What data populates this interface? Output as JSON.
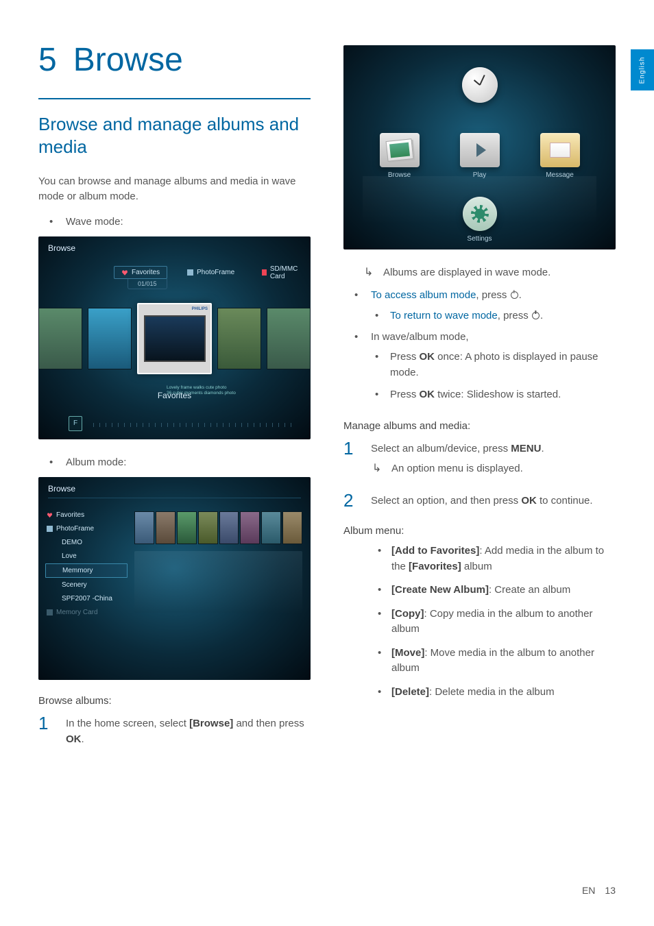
{
  "sideTab": "English",
  "chapter": {
    "num": "5",
    "title": "Browse"
  },
  "sectionTitle": "Browse and manage albums and media",
  "intro": "You can browse and manage albums and media in wave mode or album mode.",
  "waveLabel": "Wave mode:",
  "albumLabel": "Album mode:",
  "waveShot": {
    "title": "Browse",
    "tabs": [
      "Favorites",
      "PhotoFrame",
      "SD/MMC Card"
    ],
    "counter": "01/015",
    "brand": "PHILIPS",
    "caption1": "Lovely frame walks cute photo",
    "caption2": "36 cubic moments diamonds photo",
    "favLabel": "Favorites",
    "fkey": "F"
  },
  "albumShot": {
    "title": "Browse",
    "items": [
      "Favorites",
      "PhotoFrame",
      "DEMO",
      "Love",
      "Memmory",
      "Scenery",
      "SPF2007 -China",
      "Memory Card"
    ]
  },
  "homeShot": {
    "browse": "Browse",
    "play": "Play",
    "message": "Message",
    "settings": "Settings"
  },
  "browseHead": "Browse albums:",
  "step1a": "In the home screen, select ",
  "step1b": "[Browse]",
  "step1c": " and then press ",
  "step1d": "OK",
  "step1e": ".",
  "result1": "Albums are displayed in wave mode.",
  "accessA": "To access album mode",
  "accessB": ", press ",
  "returnA": "To return to wave mode",
  "returnB": ", press ",
  "inMode": "In wave/album mode,",
  "okOnceA": "Press ",
  "okOnceB": "OK",
  "okOnceC": " once: A photo is displayed in pause mode.",
  "okTwiceA": "Press ",
  "okTwiceB": "OK",
  "okTwiceC": " twice: Slideshow is started.",
  "manageHead": "Manage albums and media:",
  "mStep1a": "Select an album/device, press ",
  "mStep1b": "MENU",
  "mStep1c": ".",
  "mResult1": "An option menu is displayed.",
  "mStep2a": "Select an option, and then press ",
  "mStep2b": "OK",
  "mStep2c": " to continue.",
  "menuHead": "Album menu:",
  "menu": [
    {
      "k": "[Add to Favorites]",
      "v": ": Add media in the album to the ",
      "k2": "[Favorites]",
      "v2": " album"
    },
    {
      "k": "[Create New Album]",
      "v": ": Create an album"
    },
    {
      "k": "[Copy]",
      "v": ": Copy media in the album to another album"
    },
    {
      "k": "[Move]",
      "v": ": Move media in the album to another album"
    },
    {
      "k": "[Delete]",
      "v": ": Delete media in the album"
    }
  ],
  "footer": {
    "lang": "EN",
    "page": "13"
  }
}
